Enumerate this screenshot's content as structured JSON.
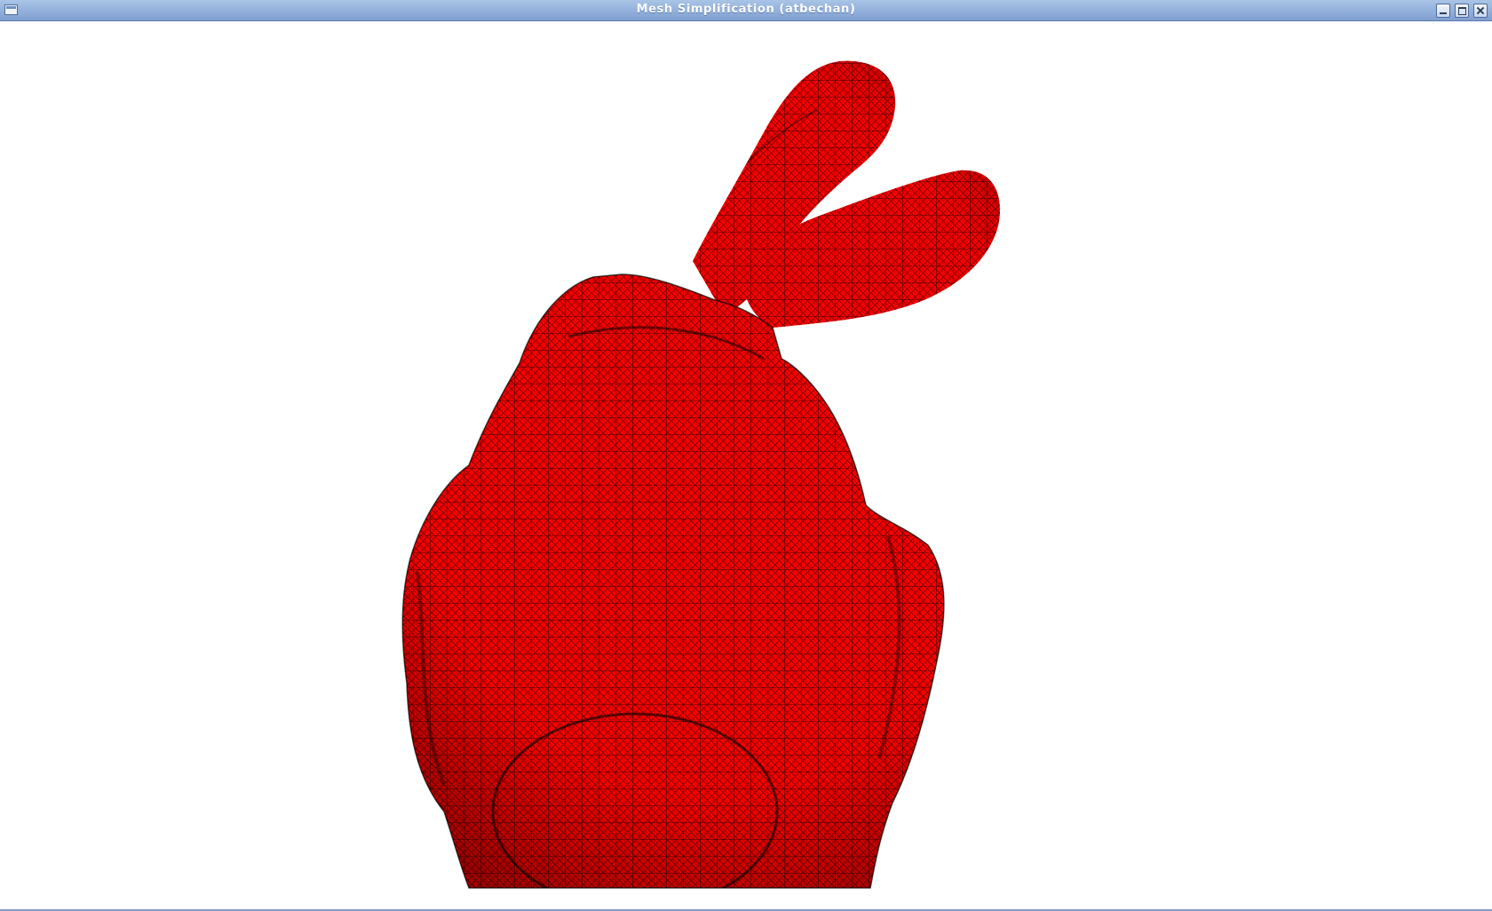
{
  "window": {
    "title": "Mesh Simplification (atbechan)"
  },
  "viewport": {
    "model_color": "#ff0000",
    "wireframe_color": "#000000",
    "background_color": "#ffffff"
  },
  "icons": {
    "window_menu": "window-menu-icon",
    "minimize": "minimize-icon",
    "maximize": "maximize-icon",
    "close": "close-icon"
  }
}
